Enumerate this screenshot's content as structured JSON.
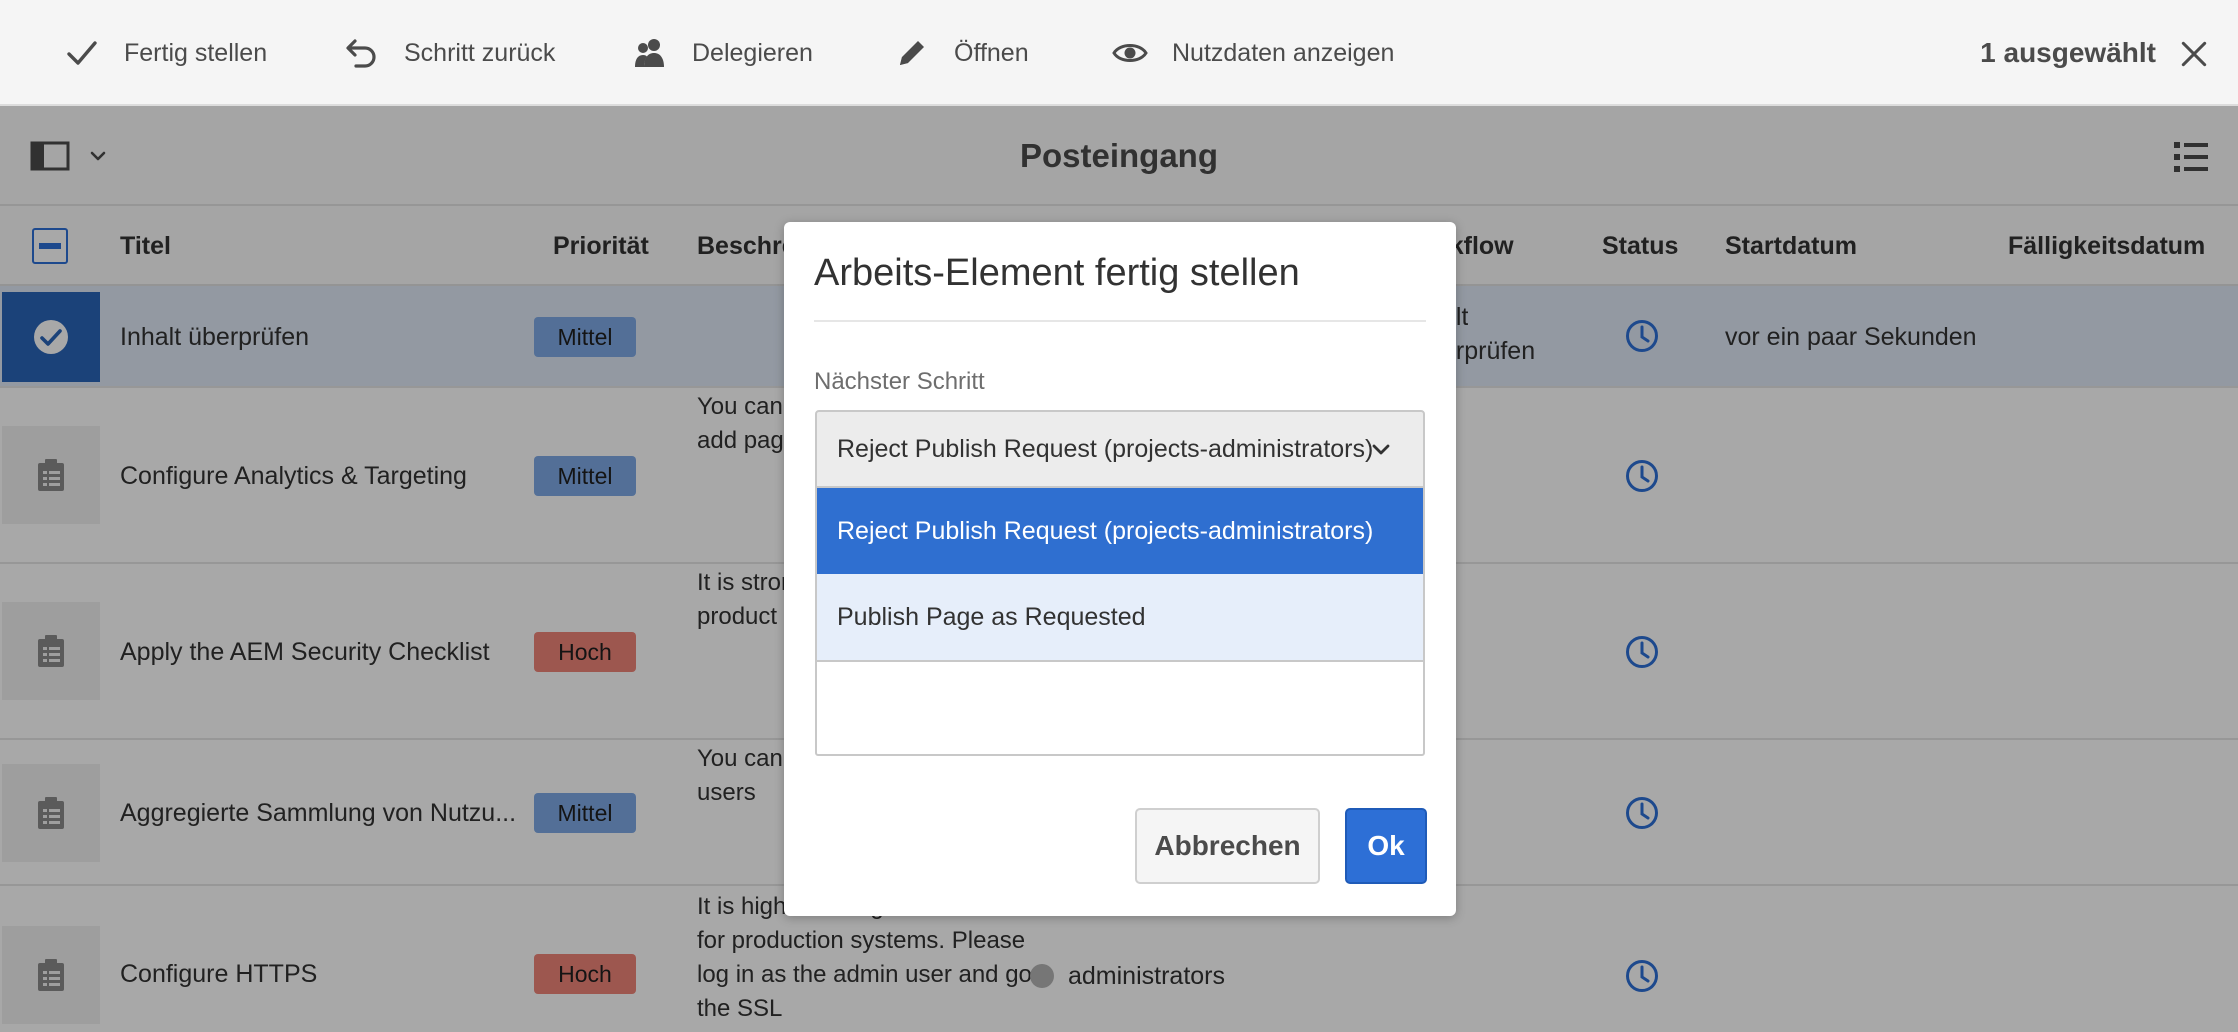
{
  "actionbar": {
    "finish": "Fertig stellen",
    "step_back": "Schritt zurück",
    "delegate": "Delegieren",
    "open": "Öffnen",
    "show_payload": "Nutzdaten anzeigen",
    "selected_count": "1 ausgewählt"
  },
  "page": {
    "title": "Posteingang"
  },
  "table": {
    "columns": {
      "title": "Titel",
      "priority": "Priorität",
      "description": "Beschre",
      "workflow": "rkflow",
      "status": "Status",
      "start_date": "Startdatum",
      "due_date": "Fälligkeitsdatum"
    },
    "rows": [
      {
        "title": "Inhalt überprüfen",
        "priority": "Mittel",
        "description": "",
        "workflow_line1": "alt",
        "workflow_line2": "erprüfen",
        "start_date": "vor ein paar Sekunden",
        "selected": true
      },
      {
        "title": "Configure Analytics & Targeting",
        "priority": "Mittel",
        "description": "You can and Targ your con then add pages."
      },
      {
        "title": "Apply the AEM Security Checklist",
        "priority": "Hoch",
        "description": "It is stron to Apply Security product review t"
      },
      {
        "title": "Aggregierte Sammlung von Nutzu...",
        "priority": "Mittel",
        "description": "You can aggrega collectio all users"
      },
      {
        "title": "Configure HTTPS",
        "priority": "Hoch",
        "description": "It is high to configure HTTPS for production systems. Please log in as the admin user and go the SSL",
        "assignee": "administrators"
      }
    ]
  },
  "dialog": {
    "title": "Arbeits-Element fertig stellen",
    "next_step_label": "Nächster Schritt",
    "selected_option": "Reject Publish Request (projects-administrators)",
    "options": [
      "Reject Publish Request (projects-administrators)",
      "Publish Page as Requested"
    ],
    "cancel": "Abbrechen",
    "ok": "Ok"
  },
  "colors": {
    "accent": "#2d6fd6",
    "badge_medium": "#7fa9e6",
    "badge_high": "#ef8479"
  }
}
